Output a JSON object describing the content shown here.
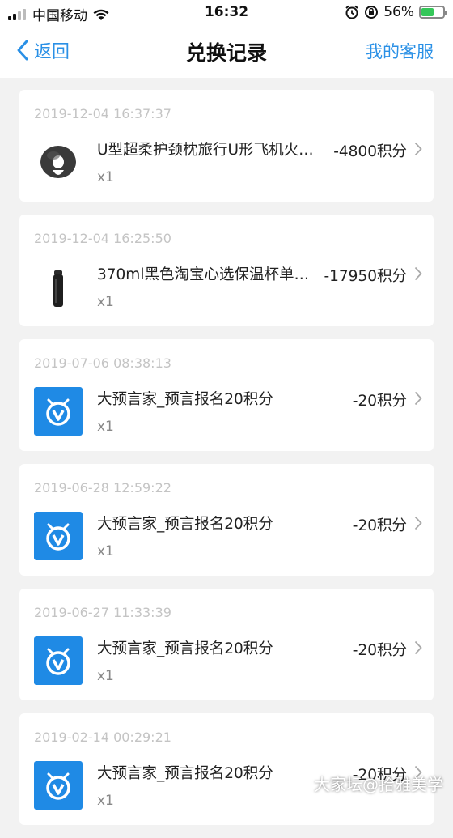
{
  "status_bar": {
    "carrier": "中国移动",
    "time": "16:32",
    "battery": "56%",
    "battery_level": 0.56,
    "icons": [
      "signal-icon",
      "wifi-icon",
      "alarm-icon",
      "orientation-lock-icon",
      "battery-icon"
    ]
  },
  "nav": {
    "back_label": "返回",
    "title": "兑换记录",
    "service_label": "我的客服",
    "accent": "#2a90e6"
  },
  "records": [
    {
      "date": "2019-12-04 16:37:37",
      "title": "U型超柔护颈枕旅行U形飞机火…",
      "qty": "x1",
      "points": "-4800积分",
      "thumb": "neck-pillow-image"
    },
    {
      "date": "2019-12-04 16:25:50",
      "title": "370ml黑色淘宝心选保温杯单…",
      "qty": "x1",
      "points": "-17950积分",
      "thumb": "thermos-cup-image"
    },
    {
      "date": "2019-07-06 08:38:13",
      "title": "大预言家_预言报名20积分",
      "qty": "x1",
      "points": "-20积分",
      "thumb": "prophet-logo-icon"
    },
    {
      "date": "2019-06-28 12:59:22",
      "title": "大预言家_预言报名20积分",
      "qty": "x1",
      "points": "-20积分",
      "thumb": "prophet-logo-icon"
    },
    {
      "date": "2019-06-27 11:33:39",
      "title": "大预言家_预言报名20积分",
      "qty": "x1",
      "points": "-20积分",
      "thumb": "prophet-logo-icon"
    },
    {
      "date": "2019-02-14 00:29:21",
      "title": "大预言家_预言报名20积分",
      "qty": "x1",
      "points": "-20积分",
      "thumb": "prophet-logo-icon"
    }
  ],
  "watermark": "大家坛@拾雅美学"
}
